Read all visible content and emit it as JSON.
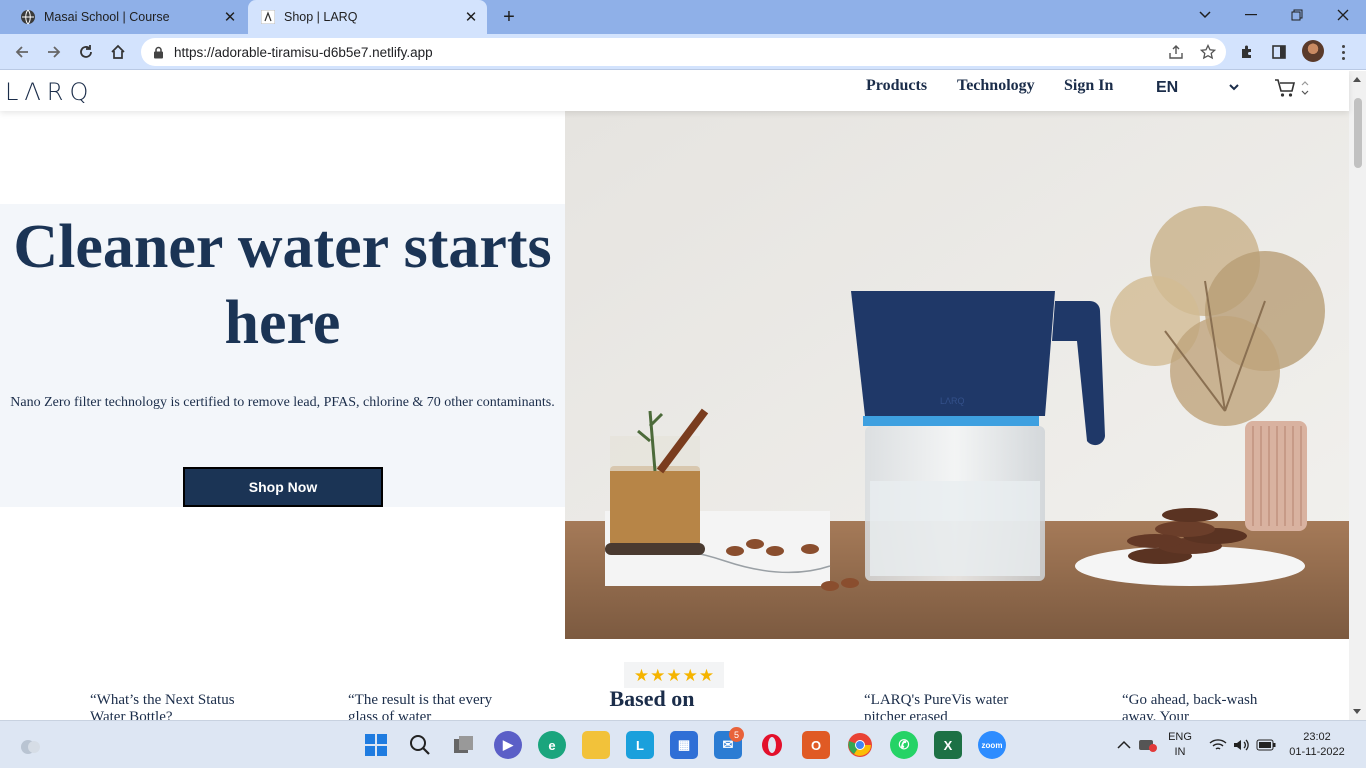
{
  "browser": {
    "tabs": [
      {
        "title": "Masai School | Course",
        "active": false
      },
      {
        "title": "Shop | LARQ",
        "active": true
      }
    ],
    "url": "https://adorable-tiramisu-d6b5e7.netlify.app"
  },
  "site": {
    "logo": "LΛRQ",
    "nav": {
      "products": "Products",
      "technology": "Technology",
      "sign_in": "Sign In",
      "language": "EN"
    }
  },
  "hero": {
    "title": "Cleaner water starts here",
    "subtitle": "Nano Zero filter technology is certified to remove lead, PFAS, chlorine & 70 other contaminants.",
    "cta": "Shop Now"
  },
  "reviews": [
    {
      "text": "“What’s the Next Status Water Bottle?"
    },
    {
      "text": "“The result is that every glass of water"
    },
    {
      "text": "“LARQ's PureVis water pitcher erased"
    },
    {
      "text": "“Go ahead, back-wash away. Your"
    }
  ],
  "rating": {
    "stars": 5,
    "label": "Based on"
  },
  "taskbar": {
    "mail_badge": "5",
    "lang_top": "ENG",
    "lang_bottom": "IN",
    "time": "23:02",
    "date": "01-11-2022"
  },
  "colors": {
    "brand_navy": "#1b3455",
    "hero_panel": "#f3f6fa",
    "star": "#f5b400"
  }
}
